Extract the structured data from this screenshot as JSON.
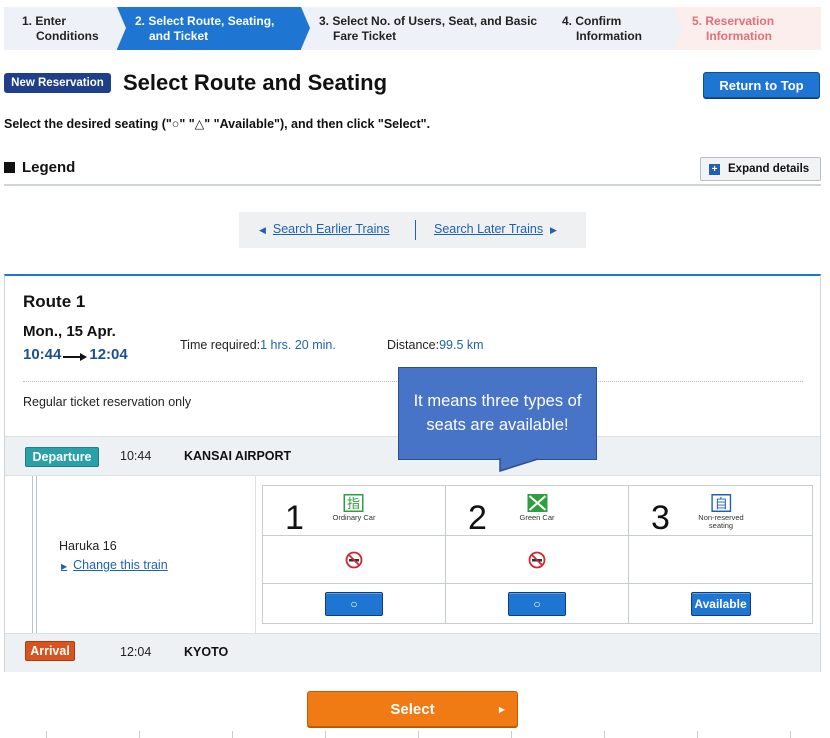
{
  "steps": [
    {
      "label_line1": "1. Enter",
      "label_line2": "Conditions"
    },
    {
      "label_line1": "2. Select Route, Seating,",
      "label_line2": "and Ticket"
    },
    {
      "label_line1": "3. Select No. of Users, Seat, and Basic",
      "label_line2": "Fare Ticket"
    },
    {
      "label_line1": "4. Confirm",
      "label_line2": "Information"
    },
    {
      "label_line1": "5. Reservation",
      "label_line2": "Information"
    }
  ],
  "header": {
    "badge": "New Reservation",
    "title": "Select Route and Seating",
    "return_button": "Return to Top"
  },
  "instruction": "Select the desired seating (\"○\" \"△\" \"Available\"), and then click \"Select\".",
  "legend": {
    "title": "Legend",
    "expand_button": "Expand details"
  },
  "search_nav": {
    "earlier": "Search Earlier Trains",
    "later": "Search Later Trains"
  },
  "route": {
    "title": "Route 1",
    "date": "Mon., 15 Apr.",
    "depart_time": "10:44",
    "arrive_time": "12:04",
    "time_required_label": "Time required:",
    "time_required_value": "1 hrs. 20 min.",
    "distance_label": "Distance:",
    "distance_value": "99.5 km",
    "note": "Regular ticket reservation only",
    "departure": {
      "tag": "Departure",
      "time": "10:44",
      "station": "KANSAI AIRPORT"
    },
    "arrival": {
      "tag": "Arrival",
      "time": "12:04",
      "station": "KYOTO"
    },
    "train_name": "Haruka 16",
    "change_link": "Change this train",
    "seats": [
      {
        "number": "1",
        "icon_char": "指",
        "label": "Ordinary Car",
        "no_smoking": true,
        "button": "○"
      },
      {
        "number": "2",
        "icon_char": "",
        "label": "Green Car",
        "no_smoking": true,
        "button": "○"
      },
      {
        "number": "3",
        "icon_char": "自",
        "label_line1": "Non-reserved",
        "label_line2": "seating",
        "no_smoking": false,
        "button": "Available"
      }
    ]
  },
  "callout": {
    "line1": "It means three types of",
    "line2": "seats are available!"
  },
  "select_button": "Select",
  "colors": {
    "primary_blue": "#1e76d2",
    "navy": "#1f3f8a",
    "orange": "#f07a14",
    "departure_teal": "#2aa0a8",
    "arrival_red": "#d9531e",
    "callout_blue": "#4774c6",
    "green_car": "#2e9e3e",
    "no_smoking_red": "#d0262d"
  }
}
